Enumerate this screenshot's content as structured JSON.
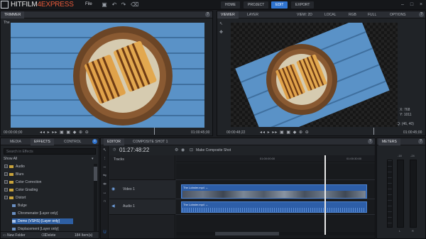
{
  "app": {
    "logo_text": "HITFILM",
    "logo_version": "4",
    "logo_suffix": "EXPRESS",
    "menu_file": "File"
  },
  "top_tabs": [
    {
      "label": "HOME"
    },
    {
      "label": "PROJECT"
    },
    {
      "label": "EDIT"
    },
    {
      "label": "EXPORT"
    }
  ],
  "trimmer": {
    "tab_label": "TRIMMER",
    "clip_name_partial": "The",
    "timecode_start": "00:00:00;00",
    "timecode_end": "01:00:45;00",
    "transport": "◂◂ ▸ ▸▸ ▣ ▣ ◆ ⊕ ⊖"
  },
  "viewer": {
    "tabs": [
      "VIEWER",
      "LAYER"
    ],
    "view_label": "VIEW: 2D",
    "space_label": "LOCAL",
    "channel_label": "RGB",
    "quality_label": "FULL",
    "options_label": "OPTIONS",
    "timecode_start": "00:00:48;22",
    "timecode_end": "01:00:45;00",
    "readout_x": "X: 768",
    "readout_y": "Y: 1011",
    "zoom_label": "Q: (46, 40)",
    "transport": "◂◂ ▸ ▸▸ ▣ ▣ ◆ ⊕ ⊖"
  },
  "media": {
    "tabs": [
      "MEDIA",
      "EFFECTS",
      "CONTROL"
    ],
    "search_placeholder": "Search in Effects",
    "show_all_label": "Show All",
    "tree": [
      {
        "label": "Audio",
        "kind": "folder",
        "indent": 0
      },
      {
        "label": "Blurs",
        "kind": "folder",
        "indent": 0
      },
      {
        "label": "Color Correction",
        "kind": "folder",
        "indent": 0
      },
      {
        "label": "Color Grading",
        "kind": "folder",
        "indent": 0
      },
      {
        "label": "Distort",
        "kind": "folder-open",
        "indent": 0
      },
      {
        "label": "Bulge",
        "kind": "effect",
        "indent": 1
      },
      {
        "label": "Chromenator [Layer only]",
        "kind": "effect",
        "indent": 1
      },
      {
        "label": "Demo (VSHS) [Layer only]",
        "kind": "effect",
        "indent": 1,
        "selected": true
      },
      {
        "label": "Displacement [Layer only]",
        "kind": "effect",
        "indent": 1
      }
    ],
    "footer_new_folder": "New Folder",
    "footer_delete": "Delete",
    "footer_count": "184 Item(s)"
  },
  "editor": {
    "tabs": [
      "EDITOR",
      "COMPOSITE SHOT 1"
    ],
    "timecode": "01:27:48:22",
    "make_composite": "Make Composite Shot",
    "tracks_label": "Tracks",
    "ruler_labels": [
      "01:00:00:00",
      "01:00:30:00"
    ],
    "video_track_label": "Video 1",
    "audio_track_label": "Audio 1",
    "video_clip_label": "The Lobster.mp4 ↔",
    "audio_clip_label": "The Lobster.mp4 ↔",
    "playhead_fraction": 0.745
  },
  "meters": {
    "title": "METERS",
    "scale": [
      "-18",
      "-24"
    ],
    "channels": [
      "L",
      "R"
    ]
  },
  "colors": {
    "accent": "#2f74d0",
    "clip_blue": "#2d5ea8",
    "sky_blue": "#5c93c8",
    "logo_accent": "#e85a3a"
  }
}
